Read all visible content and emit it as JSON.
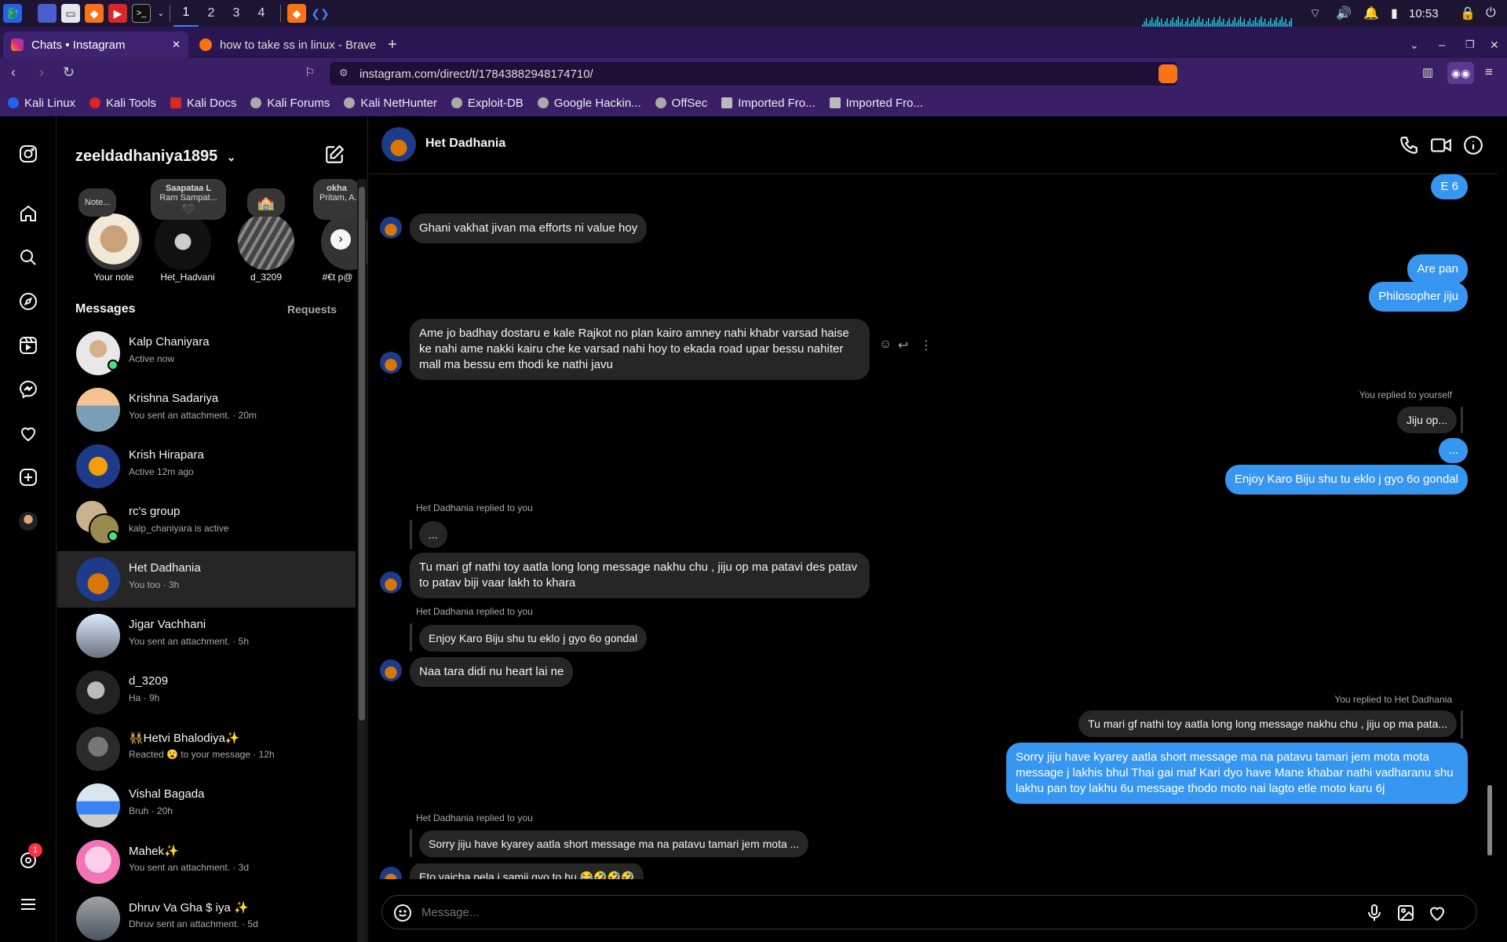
{
  "taskbar": {
    "workspaces": [
      "1",
      "2",
      "3",
      "4"
    ],
    "clock": "10:53"
  },
  "tabs": [
    {
      "title": "Chats • Instagram",
      "close": "✕"
    },
    {
      "title": "how to take ss in linux - Brave"
    }
  ],
  "address": {
    "url": "instagram.com/direct/t/17843882948174710/"
  },
  "bookmarks": [
    "Kali Linux",
    "Kali Tools",
    "Kali Docs",
    "Kali Forums",
    "Kali NetHunter",
    "Exploit-DB",
    "Google Hackin...",
    "OffSec",
    "Imported Fro...",
    "Imported Fro..."
  ],
  "inbox": {
    "username": "zeeldadhaniya1895",
    "messages_label": "Messages",
    "requests_label": "Requests",
    "stories": [
      {
        "label": "Your note",
        "note": "Note..."
      },
      {
        "label": "Het_Hadvani",
        "note": "Saapataa L",
        "note_sub": "Ram Sampat..."
      },
      {
        "label": "d_3209",
        "note": "🏫"
      },
      {
        "label": "#€t p@",
        "note": "okha",
        "note_sub": "Pritam, A..."
      }
    ],
    "conversations": [
      {
        "name": "Kalp Chaniyara",
        "preview": "Active now",
        "online": true
      },
      {
        "name": "Krishna Sadariya",
        "preview": "You sent an attachment. · 20m"
      },
      {
        "name": "Krish Hirapara",
        "preview": "Active 12m ago"
      },
      {
        "name": "rc's group",
        "preview": "kalp_chaniyara is active",
        "online": true
      },
      {
        "name": "Het Dadhania",
        "preview": "You too · 3h",
        "selected": true
      },
      {
        "name": "Jigar Vachhani",
        "preview": "You sent an attachment. · 5h"
      },
      {
        "name": "d_3209",
        "preview": "Ha · 9h"
      },
      {
        "name": "👯‍♀️Hetvi Bhalodiya✨",
        "preview": "Reacted 😮 to your message · 12h"
      },
      {
        "name": "Vishal Bagada",
        "preview": "Bruh · 20h"
      },
      {
        "name": "Mahek✨",
        "preview": "You sent an attachment. · 3d"
      },
      {
        "name": "Dhruv Va Gha $ iya ✨",
        "preview": "Dhruv sent an attachment. · 5d"
      }
    ],
    "notif_badge": "1"
  },
  "chat": {
    "contact_name": "Het Dadhania",
    "messages": {
      "m1": "E 6",
      "m2": "Ghani vakhat jivan ma efforts ni value hoy",
      "m3": "Are pan",
      "m4": "Philosopher jiju",
      "m5": "Ame jo badhay dostaru e kale Rajkot no plan kairo amney nahi khabr varsad haise ke nahi ame nakki kairu che ke varsad nahi hoy to ekada road upar bessu nahiter mall ma bessu em thodi ke nathi javu",
      "m6_meta": "You replied to yourself",
      "m6_quote": "Jiju op...",
      "m7": "...",
      "m8": "Enjoy Karo Biju shu tu eklo j gyo 6o gondal",
      "m9_meta": "Het Dadhania replied to you",
      "m9_quote": "...",
      "m9": "Tu mari gf nathi toy aatla long long message nakhu chu , jiju op ma patavi des patav to patav biji vaar lakh to khara",
      "m10_meta": "Het Dadhania replied to you",
      "m10_quote": "Enjoy Karo Biju shu tu eklo j gyo 6o gondal",
      "m10": "Naa tara didi nu heart lai ne",
      "m11_meta": "You replied to Het Dadhania",
      "m11_quote": "Tu mari gf nathi toy aatla long long message nakhu chu , jiju op ma pata...",
      "m11": "Sorry jiju have kyarey aatla short message ma na patavu tamari jem mota mota message j lakhis bhul Thai gai maf Kari dyo have Mane khabar nathi vadharanu shu lakhu pan toy lakhu 6u message thodo moto nai lagto etle moto karu 6j",
      "m12_meta": "Het Dadhania replied to you",
      "m12_quote": "Sorry jiju have kyarey aatla short message ma na patavu tamari jem mota ...",
      "m12": "Eto vaicha pela j samji gyo to hu 😂🤣🤣🤣"
    },
    "composer_placeholder": "Message..."
  }
}
